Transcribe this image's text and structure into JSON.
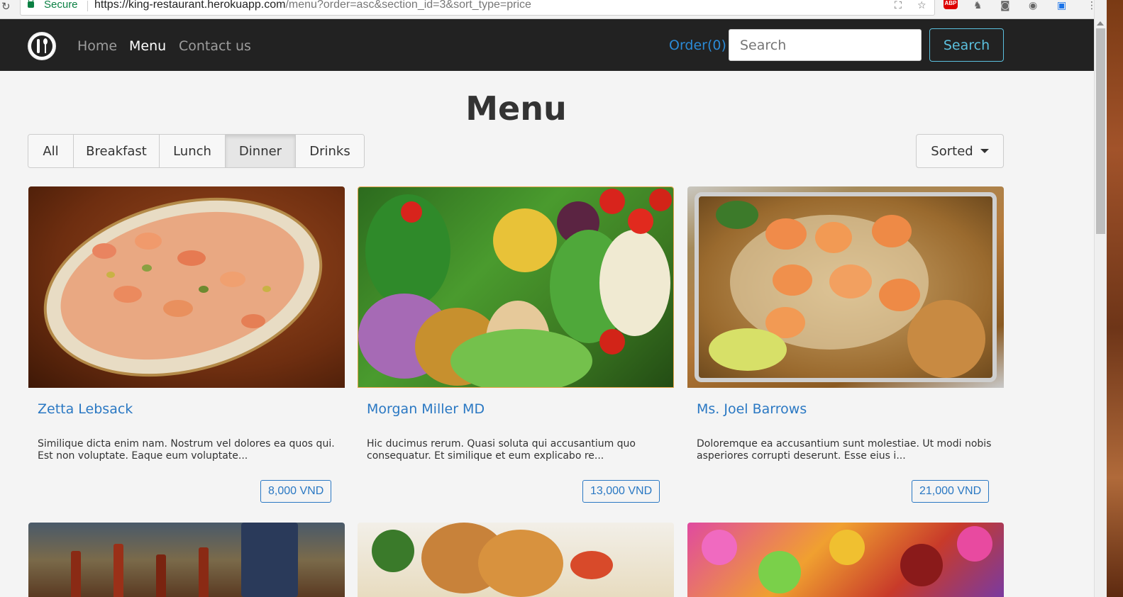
{
  "browser": {
    "secure_label": "Secure",
    "url_host": "https://king-restaurant.herokuapp.com",
    "url_path": "/menu?order=asc&section_id=3&sort_type=price",
    "abp_label": "ABP"
  },
  "navbar": {
    "links": [
      {
        "label": "Home",
        "active": false
      },
      {
        "label": "Menu",
        "active": true
      },
      {
        "label": "Contact us",
        "active": false
      }
    ],
    "order_label": "Order(0)",
    "search_placeholder": "Search",
    "search_button": "Search"
  },
  "page": {
    "title": "Menu",
    "sections": [
      {
        "label": "All",
        "active": false
      },
      {
        "label": "Breakfast",
        "active": false
      },
      {
        "label": "Lunch",
        "active": false
      },
      {
        "label": "Dinner",
        "active": true
      },
      {
        "label": "Drinks",
        "active": false
      }
    ],
    "sort_label": "Sorted"
  },
  "dishes": [
    {
      "name": "Zetta Lebsack",
      "description": "Similique dicta enim nam. Nostrum vel dolores ea quos qui. Est non voluptate. Eaque eum voluptate...",
      "price": "8,000 VND",
      "image": "salmon-plate"
    },
    {
      "name": "Morgan Miller MD",
      "description": "Hic ducimus rerum. Quasi soluta qui accusantium quo consequatur. Et similique et eum explicabo re...",
      "price": "13,000 VND",
      "image": "vegetables"
    },
    {
      "name": "Ms. Joel Barrows",
      "description": "Doloremque ea accusantium sunt molestiae. Ut modi nobis asperiores corrupti deserunt. Esse eius i...",
      "price": "21,000 VND",
      "image": "shrimp-pad-thai"
    }
  ],
  "colors": {
    "navbar_bg": "#222222",
    "link_blue": "#2a78c3",
    "search_btn": "#5bc0de",
    "page_bg": "#f4f4f4"
  }
}
